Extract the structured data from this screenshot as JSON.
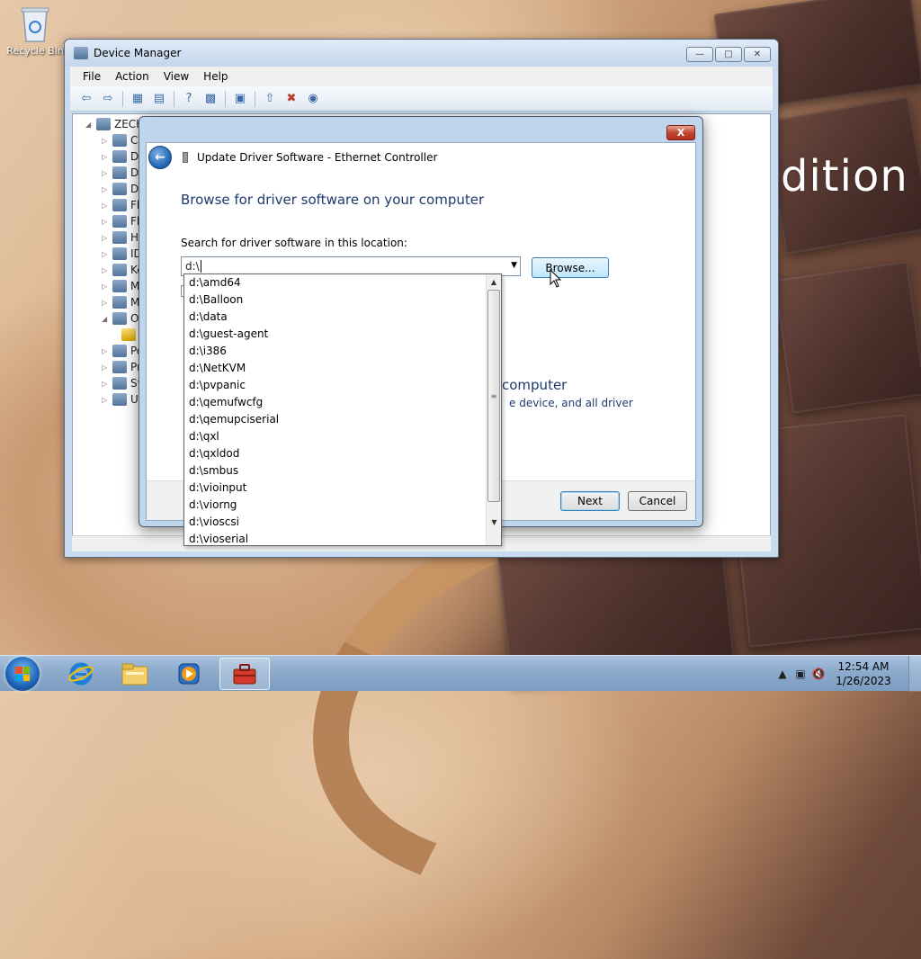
{
  "desktop": {
    "recycle_bin_label": "Recycle Bin",
    "wallpaper_text": "dition"
  },
  "device_manager": {
    "title": "Device Manager",
    "menu": [
      "File",
      "Action",
      "View",
      "Help"
    ],
    "tree": {
      "root": "ZECH",
      "items": [
        "Co",
        "Di",
        "Di",
        "DV",
        "Fl",
        "Fl",
        "Hu",
        "ID",
        "Ke",
        "M",
        "M",
        "Ot",
        "",
        "Po",
        "Pr",
        "Sy",
        "Ur"
      ]
    }
  },
  "dialog": {
    "title": "Update Driver Software - Ethernet Controller",
    "heading": "Browse for driver software on your computer",
    "search_label": "Search for driver software in this location:",
    "path_value": "d:\\",
    "browse_label": "Browse...",
    "partial_heading": "computer",
    "partial_text": "e device, and all driver",
    "next_label": "Next",
    "cancel_label": "Cancel",
    "close_label": "X"
  },
  "dropdown": {
    "items": [
      "d:\\amd64",
      "d:\\Balloon",
      "d:\\data",
      "d:\\guest-agent",
      "d:\\i386",
      "d:\\NetKVM",
      "d:\\pvpanic",
      "d:\\qemufwcfg",
      "d:\\qemupciserial",
      "d:\\qxl",
      "d:\\qxldod",
      "d:\\smbus",
      "d:\\vioinput",
      "d:\\viorng",
      "d:\\vioscsi",
      "d:\\vioserial"
    ]
  },
  "taskbar": {
    "time": "12:54 AM",
    "date": "1/26/2023",
    "apps": [
      "internet-explorer",
      "windows-explorer",
      "media-player",
      "device-manager"
    ]
  }
}
